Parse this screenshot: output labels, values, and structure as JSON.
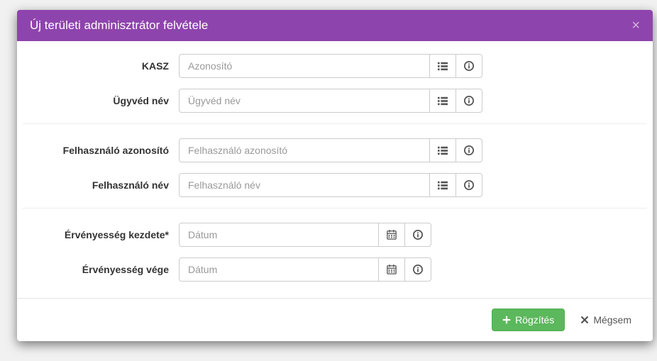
{
  "modal": {
    "title": "Új területi adminisztrátor felvétele"
  },
  "fields": {
    "kasz": {
      "label": "KASZ",
      "placeholder": "Azonosító"
    },
    "ugyved_nev": {
      "label": "Ügyvéd név",
      "placeholder": "Ügyvéd név"
    },
    "felh_azon": {
      "label": "Felhasználó azonosító",
      "placeholder": "Felhasználó azonosító"
    },
    "felh_nev": {
      "label": "Felhasználó név",
      "placeholder": "Felhasználó név"
    },
    "erv_kezdete": {
      "label": "Érvényesség kezdete*",
      "placeholder": "Dátum"
    },
    "erv_vege": {
      "label": "Érvényesség vége",
      "placeholder": "Dátum"
    }
  },
  "buttons": {
    "save": "Rögzítés",
    "cancel": "Mégsem"
  }
}
